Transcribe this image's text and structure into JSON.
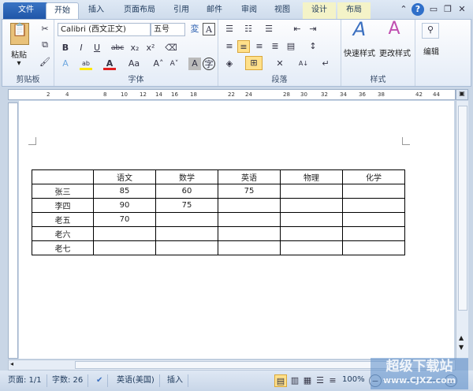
{
  "tabs": [
    {
      "label": "文件"
    },
    {
      "label": "开始"
    },
    {
      "label": "插入"
    },
    {
      "label": "页面布局"
    },
    {
      "label": "引用"
    },
    {
      "label": "邮件"
    },
    {
      "label": "审阅"
    },
    {
      "label": "视图"
    },
    {
      "label": "设计"
    },
    {
      "label": "布局"
    }
  ],
  "active_tab": "开始",
  "ribbon": {
    "clipboard": {
      "label": "剪贴板",
      "paste": "粘贴"
    },
    "font": {
      "label": "字体",
      "font_name": "Calibri (西文正文)",
      "font_size": "五号"
    },
    "paragraph": {
      "label": "段落"
    },
    "styles": {
      "label": "样式",
      "quick": "快速样式",
      "change": "更改样式"
    },
    "editing": {
      "label": "编辑"
    }
  },
  "ruler": {
    "ticks": [
      "2",
      "4",
      "8",
      "10",
      "12",
      "14",
      "16",
      "18",
      "22",
      "24",
      "28",
      "30",
      "32",
      "34",
      "36",
      "38",
      "42",
      "44"
    ]
  },
  "table": {
    "header": [
      "",
      "语文",
      "数学",
      "英语",
      "物理",
      "化学"
    ],
    "rows": [
      [
        "张三",
        "85",
        "60",
        "75",
        "",
        ""
      ],
      [
        "李四",
        "90",
        "75",
        "",
        "",
        ""
      ],
      [
        "老五",
        "70",
        "",
        "",
        "",
        ""
      ],
      [
        "老六",
        "",
        "",
        "",
        "",
        ""
      ],
      [
        "老七",
        "",
        "",
        "",
        "",
        ""
      ]
    ]
  },
  "status": {
    "page": "页面: 1/1",
    "words": "字数: 26",
    "language": "英语(美国)",
    "mode": "插入",
    "zoom": "100%"
  },
  "watermark": {
    "title": "超级下载站",
    "url": "www.CJXZ.com"
  },
  "colors": {
    "file_tab": "#2a62b4",
    "highlight": "#ffe98a",
    "font_color": "#e02020"
  }
}
